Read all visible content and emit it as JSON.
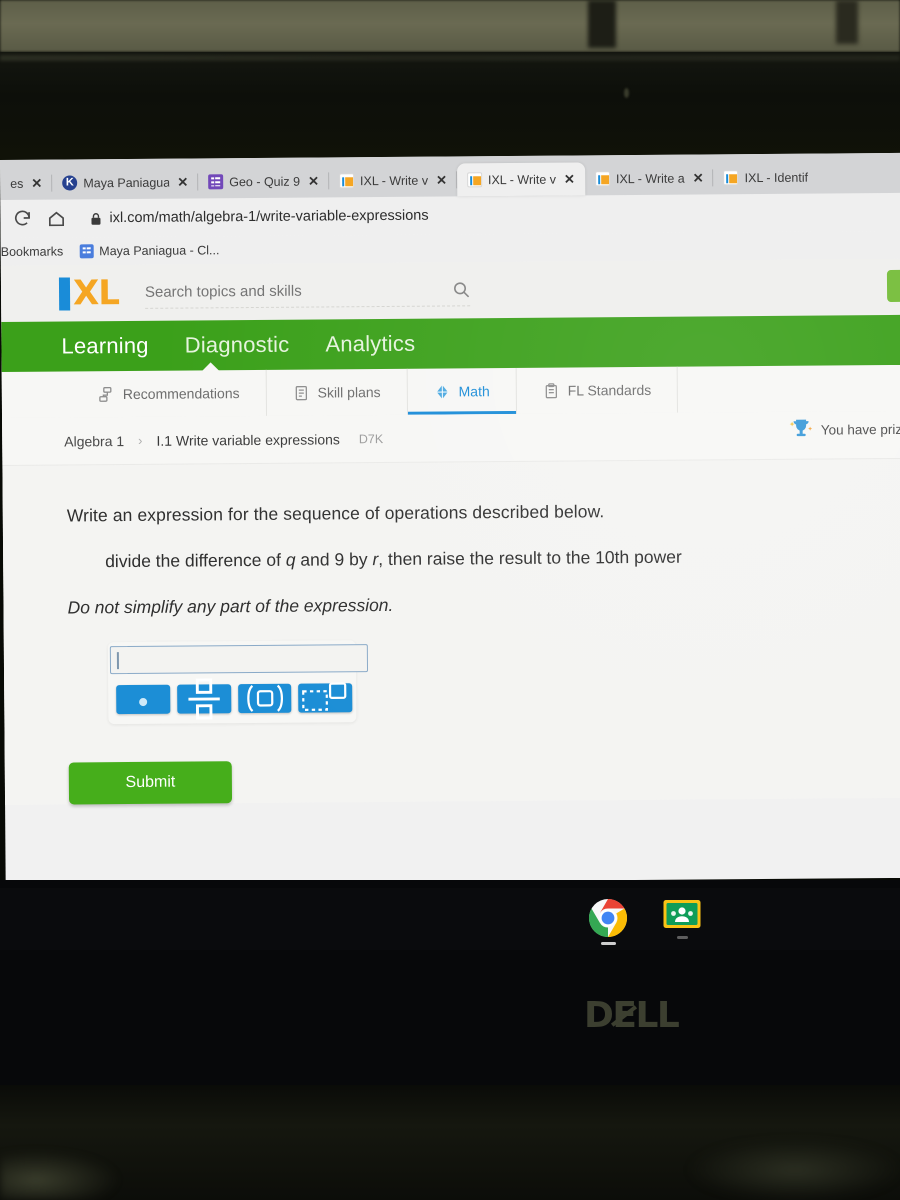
{
  "browser": {
    "tabs": [
      {
        "title": "es",
        "favicon": "none",
        "active": false,
        "close_label": "✕"
      },
      {
        "title": "Maya Paniagua",
        "favicon": "kahoot-icon",
        "active": false,
        "close_label": "✕"
      },
      {
        "title": "Geo - Quiz 9",
        "favicon": "google-forms-icon",
        "active": false,
        "close_label": "✕"
      },
      {
        "title": "IXL - Write v",
        "favicon": "ixl-icon",
        "active": false,
        "close_label": "✕"
      },
      {
        "title": "IXL - Write v",
        "favicon": "ixl-icon",
        "active": true,
        "close_label": "✕"
      },
      {
        "title": "IXL - Write a",
        "favicon": "ixl-icon",
        "active": false,
        "close_label": "✕"
      },
      {
        "title": "IXL - Identif",
        "favicon": "ixl-icon",
        "active": false,
        "close_label": ""
      }
    ],
    "reload_label": "reload-icon",
    "home_label": "home-icon",
    "url": "ixl.com/math/algebra-1/write-variable-expressions",
    "bookmarks_label": "Bookmarks",
    "bookmark_items": [
      {
        "label": "Maya Paniagua - Cl..."
      }
    ]
  },
  "ixl": {
    "logo_i": "I",
    "logo_xl": "XL",
    "search_placeholder": "Search topics and skills",
    "search_value": "",
    "nav": [
      {
        "label": "Learning",
        "active": true
      },
      {
        "label": "Diagnostic",
        "active": false
      },
      {
        "label": "Analytics",
        "active": false
      }
    ],
    "subnav": [
      {
        "label": "Recommendations",
        "icon": "recommendations-icon",
        "active": false
      },
      {
        "label": "Skill plans",
        "icon": "skill-plans-icon",
        "active": false
      },
      {
        "label": "Math",
        "icon": "math-icon",
        "active": true
      },
      {
        "label": "FL Standards",
        "icon": "standards-icon",
        "active": false
      }
    ],
    "breadcrumb": {
      "course": "Algebra 1",
      "separator": "›",
      "skill": "I.1 Write variable expressions",
      "code": "D7K"
    },
    "prize_banner": {
      "icon": "trophy-icon",
      "text": "You have priz"
    },
    "colors": {
      "green_nav": "#3ba01a",
      "submit_green": "#46ae1b",
      "accent_blue": "#1a8cd8",
      "math_button_blue": "#1c8ed6",
      "logo_orange": "#f5a623"
    }
  },
  "question": {
    "prompt": "Write an expression for the sequence of operations described below.",
    "instruction_pre": "divide the difference of ",
    "instruction_var1": "q",
    "instruction_mid": " and 9 by ",
    "instruction_var2": "r",
    "instruction_post": ", then raise the result to the 10th power",
    "note": "Do not simplify any part of the expression.",
    "answer_value": "",
    "math_buttons": [
      {
        "name": "multiply-dot-button",
        "glyph": "·"
      },
      {
        "name": "fraction-button",
        "glyph": "□/□"
      },
      {
        "name": "parentheses-button",
        "glyph": "(□)"
      },
      {
        "name": "exponent-button",
        "glyph": "□^□"
      }
    ],
    "submit_label": "Submit"
  },
  "taskbar": {
    "items": [
      {
        "name": "chrome-icon",
        "label": "Google Chrome",
        "running": true
      },
      {
        "name": "google-classroom-icon",
        "label": "Google Classroom",
        "running": true
      }
    ]
  },
  "hardware": {
    "brand_d": "D",
    "brand_e": "E",
    "brand_ll": "LL"
  }
}
